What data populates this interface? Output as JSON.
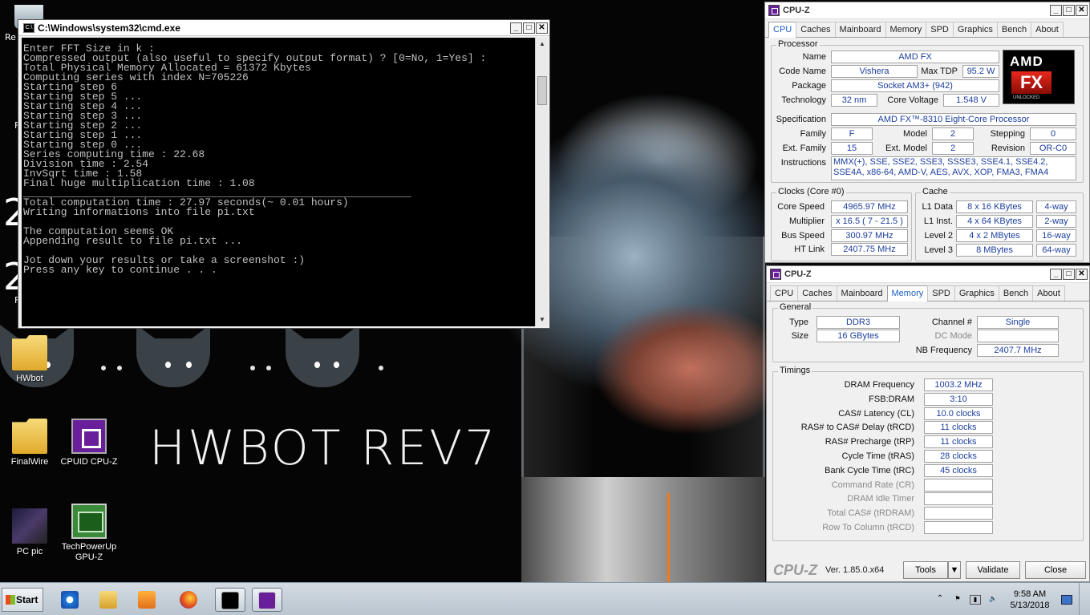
{
  "desktop": {
    "banner": "HWBOT REV7",
    "icons": [
      {
        "label": "HWbot"
      },
      {
        "label": "FinalWire"
      },
      {
        "label": "CPUID CPU-Z"
      },
      {
        "label": "PC pic"
      },
      {
        "label": "TechPowerUp GPU-Z"
      }
    ],
    "partial_labels": [
      "Re",
      "F",
      "2",
      "2",
      "F"
    ]
  },
  "cmd": {
    "title": "C:\\Windows\\system32\\cmd.exe",
    "lines": [
      "Enter FFT Size in k :",
      "Compressed output (also useful to specify output format) ? [0=No, 1=Yes] :",
      "Total Physical Memory Allocated = 61372 Kbytes",
      "Computing series with index N=705226",
      "Starting step 6",
      "Starting step 5 ...",
      "Starting step 4 ...",
      "Starting step 3 ...",
      "Starting step 2 ...",
      "Starting step 1 ...",
      "Starting step 0 ...",
      "Series computing time : 22.68",
      "Division time : 2.54",
      "InvSqrt time : 1.58",
      "Final huge multiplication time : 1.08",
      "______________________________________________________________",
      "Total computation time : 27.97 seconds(~ 0.01 hours)",
      "Writing informations into file pi.txt",
      "",
      "The computation seems OK",
      "Appending result to file pi.txt ...",
      "",
      "Jot down your results or take a screenshot :)",
      "Press any key to continue . . ."
    ]
  },
  "cpuz_cpu": {
    "title": "CPU-Z",
    "tabs": [
      "CPU",
      "Caches",
      "Mainboard",
      "Memory",
      "SPD",
      "Graphics",
      "Bench",
      "About"
    ],
    "active_tab": "CPU",
    "processor_group": "Processor",
    "labels": {
      "name": "Name",
      "code_name": "Code Name",
      "max_tdp": "Max TDP",
      "package": "Package",
      "technology": "Technology",
      "core_voltage": "Core Voltage",
      "specification": "Specification",
      "family": "Family",
      "model": "Model",
      "stepping": "Stepping",
      "ext_family": "Ext. Family",
      "ext_model": "Ext. Model",
      "revision": "Revision",
      "instructions": "Instructions"
    },
    "values": {
      "name": "AMD FX",
      "code_name": "Vishera",
      "max_tdp": "95.2 W",
      "package": "Socket AM3+ (942)",
      "technology": "32 nm",
      "core_voltage": "1.548 V",
      "specification": "AMD FX™-8310 Eight-Core Processor",
      "family": "F",
      "model": "2",
      "stepping": "0",
      "ext_family": "15",
      "ext_model": "2",
      "revision": "OR-C0",
      "instructions": "MMX(+), SSE, SSE2, SSE3, SSSE3, SSE4.1, SSE4.2, SSE4A, x86-64, AMD-V, AES, AVX, XOP, FMA3, FMA4"
    },
    "logo": {
      "brand": "AMD",
      "fx": "FX",
      "sub": "UNLOCKED"
    },
    "clocks_group": "Clocks (Core #0)",
    "clocks": {
      "core_speed_label": "Core Speed",
      "core_speed": "4965.97 MHz",
      "multiplier_label": "Multiplier",
      "multiplier": "x 16.5 ( 7 - 21.5 )",
      "bus_speed_label": "Bus Speed",
      "bus_speed": "300.97 MHz",
      "ht_link_label": "HT Link",
      "ht_link": "2407.75 MHz"
    },
    "cache_group": "Cache",
    "cache": [
      {
        "label": "L1 Data",
        "size": "8 x 16 KBytes",
        "way": "4-way"
      },
      {
        "label": "L1 Inst.",
        "size": "4 x 64 KBytes",
        "way": "2-way"
      },
      {
        "label": "Level 2",
        "size": "4 x 2 MBytes",
        "way": "16-way"
      },
      {
        "label": "Level 3",
        "size": "8 MBytes",
        "way": "64-way"
      }
    ]
  },
  "cpuz_mem": {
    "title": "CPU-Z",
    "tabs": [
      "CPU",
      "Caches",
      "Mainboard",
      "Memory",
      "SPD",
      "Graphics",
      "Bench",
      "About"
    ],
    "active_tab": "Memory",
    "general_group": "General",
    "type_label": "Type",
    "type": "DDR3",
    "size_label": "Size",
    "size": "16 GBytes",
    "channel_label": "Channel #",
    "channel": "Single",
    "dc_mode_label": "DC Mode",
    "dc_mode": "",
    "nb_freq_label": "NB Frequency",
    "nb_freq": "2407.7 MHz",
    "timings_group": "Timings",
    "timings": [
      {
        "label": "DRAM Frequency",
        "value": "1003.2 MHz",
        "dim": false
      },
      {
        "label": "FSB:DRAM",
        "value": "3:10",
        "dim": false
      },
      {
        "label": "CAS# Latency (CL)",
        "value": "10.0 clocks",
        "dim": false
      },
      {
        "label": "RAS# to CAS# Delay (tRCD)",
        "value": "11 clocks",
        "dim": false
      },
      {
        "label": "RAS# Precharge (tRP)",
        "value": "11 clocks",
        "dim": false
      },
      {
        "label": "Cycle Time (tRAS)",
        "value": "28 clocks",
        "dim": false
      },
      {
        "label": "Bank Cycle Time (tRC)",
        "value": "45 clocks",
        "dim": false
      },
      {
        "label": "Command Rate (CR)",
        "value": "",
        "dim": true
      },
      {
        "label": "DRAM Idle Timer",
        "value": "",
        "dim": true
      },
      {
        "label": "Total CAS# (tRDRAM)",
        "value": "",
        "dim": true
      },
      {
        "label": "Row To Column (tRCD)",
        "value": "",
        "dim": true
      }
    ],
    "footer": {
      "brand": "CPU-Z",
      "version": "Ver. 1.85.0.x64",
      "tools": "Tools",
      "validate": "Validate",
      "close": "Close"
    }
  },
  "taskbar": {
    "start": "Start",
    "time": "9:58 AM",
    "date": "5/13/2018"
  }
}
